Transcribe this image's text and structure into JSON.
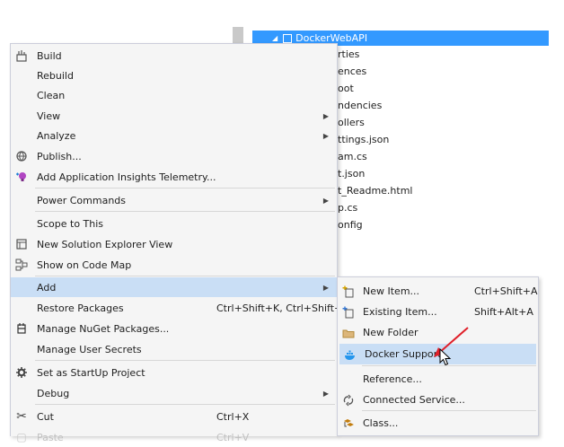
{
  "explorer": {
    "project_name": "DockerWebAPI",
    "tree_items": [
      "rties",
      "ences",
      "oot",
      "ndencies",
      "ollers",
      "ttings.json",
      "am.cs",
      "t.json",
      "t_Readme.html",
      "p.cs",
      "onfig"
    ]
  },
  "context_menu": {
    "items": [
      {
        "label": "Build",
        "icon": "build-icon"
      },
      {
        "label": "Rebuild"
      },
      {
        "label": "Clean"
      },
      {
        "label": "View",
        "submenu": true
      },
      {
        "label": "Analyze",
        "submenu": true
      },
      {
        "label": "Publish...",
        "icon": "publish-icon"
      },
      {
        "label": "Add Application Insights Telemetry...",
        "icon": "app-insights-icon"
      },
      {
        "label": "Power Commands",
        "submenu": true
      },
      {
        "label": "Scope to This"
      },
      {
        "label": "New Solution Explorer View",
        "icon": "new-view-icon"
      },
      {
        "label": "Show on Code Map",
        "icon": "code-map-icon"
      },
      {
        "label": "Add",
        "submenu": true,
        "highlighted": true
      },
      {
        "label": "Restore Packages",
        "shortcut": "Ctrl+Shift+K, Ctrl+Shift+R"
      },
      {
        "label": "Manage NuGet Packages...",
        "icon": "nuget-icon"
      },
      {
        "label": "Manage User Secrets"
      },
      {
        "label": "Set as StartUp Project",
        "icon": "gear-icon"
      },
      {
        "label": "Debug",
        "submenu": true
      },
      {
        "label": "Cut",
        "icon": "scissors-icon",
        "shortcut": "Ctrl+X"
      },
      {
        "label": "Paste",
        "shortcut": "Ctrl+V",
        "disabled": true
      }
    ]
  },
  "add_submenu": {
    "items": [
      {
        "label": "New Item...",
        "shortcut": "Ctrl+Shift+A",
        "icon": "new-item-icon"
      },
      {
        "label": "Existing Item...",
        "shortcut": "Shift+Alt+A",
        "icon": "existing-item-icon"
      },
      {
        "label": "New Folder",
        "icon": "folder-icon"
      },
      {
        "label": "Docker Support",
        "icon": "docker-icon",
        "highlighted": true
      },
      {
        "label": "Reference..."
      },
      {
        "label": "Connected Service...",
        "icon": "connected-service-icon"
      },
      {
        "label": "Class...",
        "icon": "class-icon"
      }
    ]
  },
  "colors": {
    "selection": "#3399ff",
    "menu_bg": "#f5f5f5",
    "menu_highlight": "#c9def5",
    "annotation_arrow": "#e0202a"
  }
}
